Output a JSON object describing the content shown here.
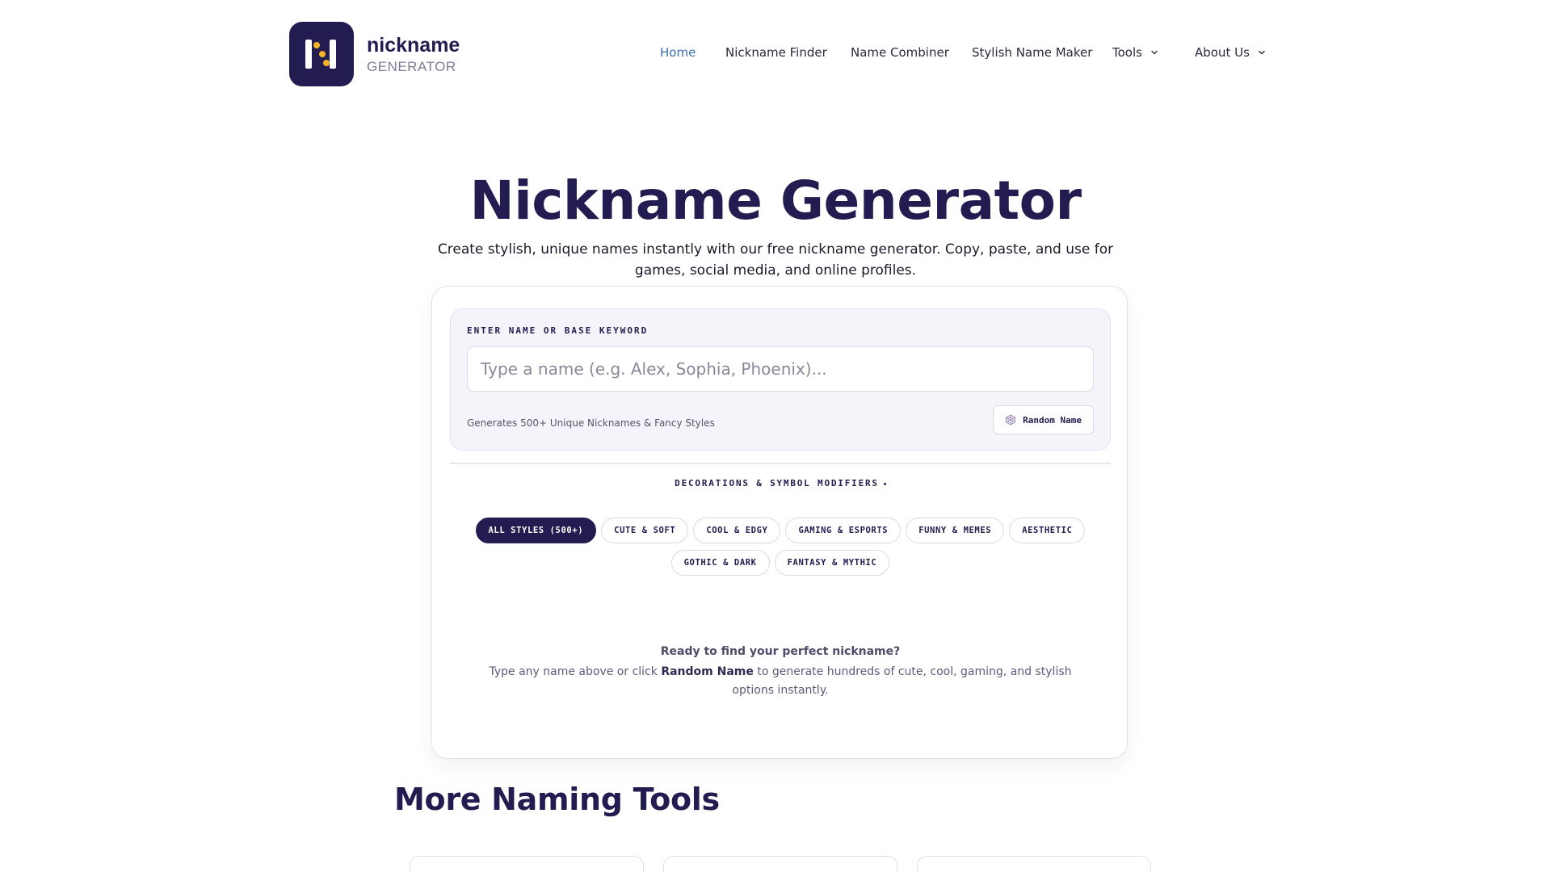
{
  "logo": {
    "line1": "nickname",
    "line2": "GENERATOR"
  },
  "nav": {
    "home": "Home",
    "nickname_finder": "Nickname Finder",
    "name_combiner": "Name Combiner",
    "stylish_name_maker": "Stylish Name Maker",
    "tools": "Tools",
    "about_us": "About Us"
  },
  "hero": {
    "title": "Nickname Generator",
    "subtitle": "Create stylish, unique names instantly with our free nickname generator. Copy, paste, and use for games, social media, and online profiles."
  },
  "generator": {
    "label": "ENTER NAME OR BASE KEYWORD",
    "placeholder": "Type a name (e.g. Alex, Sophia, Phoenix)...",
    "value": "",
    "hint": "Generates 500+ Unique Nicknames & Fancy Styles",
    "random_button": "Random Name"
  },
  "modifiers": {
    "title": "DECORATIONS & SYMBOL MODIFIERS",
    "chips_row1": [
      "ALL STYLES (500+)",
      "CUTE & SOFT",
      "COOL & EDGY",
      "GAMING & ESPORTS",
      "FUNNY & MEMES",
      "AESTHETIC"
    ],
    "chips_row2": [
      "GOTHIC & DARK",
      "FANTASY & MYTHIC"
    ],
    "active": "ALL STYLES (500+)"
  },
  "empty_state": {
    "title": "Ready to find your perfect nickname?",
    "text_before": "Type any name above or click ",
    "text_bold": "Random Name",
    "text_after": " to generate hundreds of cute, cool, gaming, and stylish options instantly."
  },
  "more_tools": {
    "title": "More Naming Tools"
  },
  "colors": {
    "brand": "#221c50",
    "accent": "#f5b32a",
    "link_active": "#3a6fb5"
  },
  "icons": {
    "random": "dice-icon",
    "dropdown": "chevron-down-icon"
  }
}
